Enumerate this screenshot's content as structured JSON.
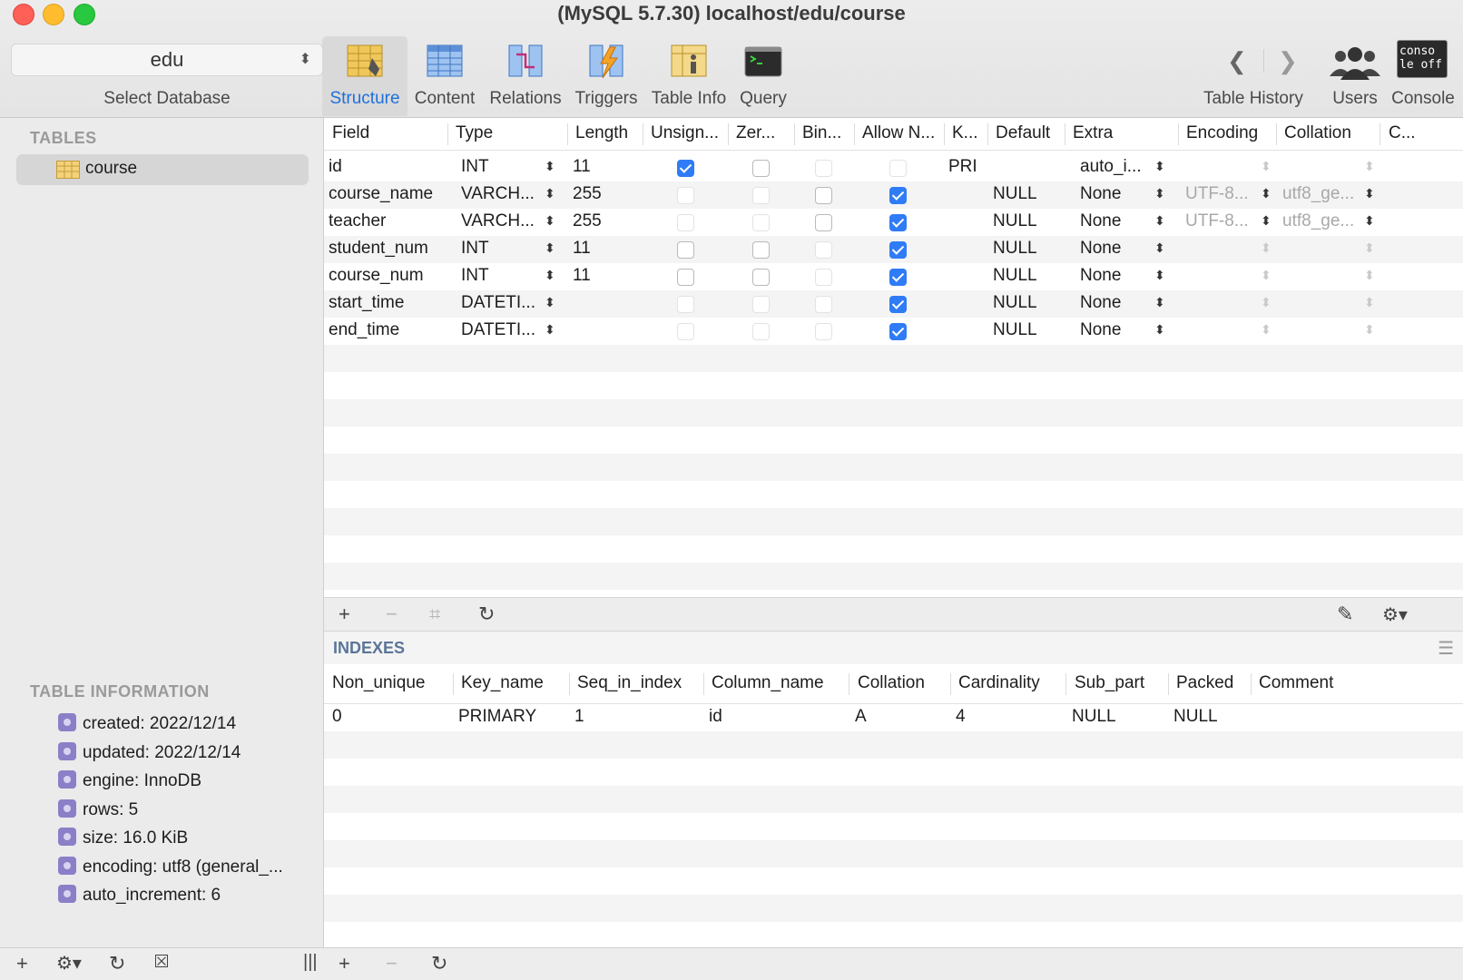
{
  "window": {
    "title": "(MySQL 5.7.30) localhost/edu/course"
  },
  "database": {
    "selected": "edu",
    "label": "Select Database"
  },
  "toolbar": {
    "tabs": [
      {
        "label": "Structure",
        "icon": "structure-icon",
        "active": true
      },
      {
        "label": "Content",
        "icon": "content-icon",
        "active": false
      },
      {
        "label": "Relations",
        "icon": "relations-icon",
        "active": false
      },
      {
        "label": "Triggers",
        "icon": "triggers-icon",
        "active": false
      },
      {
        "label": "Table Info",
        "icon": "table-info-icon",
        "active": false
      },
      {
        "label": "Query",
        "icon": "query-icon",
        "active": false
      }
    ],
    "right": {
      "history_label": "Table History",
      "users_label": "Users",
      "console_label": "Console",
      "console_icon_text": "conso le off"
    }
  },
  "sidebar": {
    "tables_heading": "TABLES",
    "tables": [
      {
        "name": "course",
        "selected": true
      }
    ],
    "info_heading": "TABLE INFORMATION",
    "info": [
      "created: 2022/12/14",
      "updated: 2022/12/14",
      "engine: InnoDB",
      "rows: 5",
      "size: 16.0 KiB",
      "encoding: utf8 (general_...",
      "auto_increment: 6"
    ]
  },
  "structure": {
    "columns": [
      "Field",
      "Type",
      "Length",
      "Unsign...",
      "Zer...",
      "Bin...",
      "Allow N...",
      "K...",
      "Default",
      "Extra",
      "Encoding",
      "Collation",
      "C..."
    ],
    "rows": [
      {
        "field": "id",
        "type": "INT",
        "length": "11",
        "unsigned": true,
        "zerofill": false,
        "binary": false,
        "allow_null": false,
        "key": "PRI",
        "default": "",
        "extra": "auto_i...",
        "encoding": "",
        "collation": ""
      },
      {
        "field": "course_name",
        "type": "VARCH...",
        "length": "255",
        "unsigned": false,
        "zerofill": false,
        "binary": false,
        "allow_null": true,
        "key": "",
        "default": "NULL",
        "extra": "None",
        "encoding": "UTF-8...",
        "collation": "utf8_ge..."
      },
      {
        "field": "teacher",
        "type": "VARCH...",
        "length": "255",
        "unsigned": false,
        "zerofill": false,
        "binary": false,
        "allow_null": true,
        "key": "",
        "default": "NULL",
        "extra": "None",
        "encoding": "UTF-8...",
        "collation": "utf8_ge..."
      },
      {
        "field": "student_num",
        "type": "INT",
        "length": "11",
        "unsigned": false,
        "zerofill": false,
        "binary": false,
        "allow_null": true,
        "key": "",
        "default": "NULL",
        "extra": "None",
        "encoding": "",
        "collation": ""
      },
      {
        "field": "course_num",
        "type": "INT",
        "length": "11",
        "unsigned": false,
        "zerofill": false,
        "binary": false,
        "allow_null": true,
        "key": "",
        "default": "NULL",
        "extra": "None",
        "encoding": "",
        "collation": ""
      },
      {
        "field": "start_time",
        "type": "DATETI...",
        "length": "",
        "unsigned": false,
        "zerofill": false,
        "binary": false,
        "allow_null": true,
        "key": "",
        "default": "NULL",
        "extra": "None",
        "encoding": "",
        "collation": ""
      },
      {
        "field": "end_time",
        "type": "DATETI...",
        "length": "",
        "unsigned": false,
        "zerofill": false,
        "binary": false,
        "allow_null": true,
        "key": "",
        "default": "NULL",
        "extra": "None",
        "encoding": "",
        "collation": ""
      }
    ]
  },
  "indexes": {
    "heading": "INDEXES",
    "columns": [
      "Non_unique",
      "Key_name",
      "Seq_in_index",
      "Column_name",
      "Collation",
      "Cardinality",
      "Sub_part",
      "Packed",
      "Comment"
    ],
    "rows": [
      [
        "0",
        "PRIMARY",
        "1",
        "id",
        "A",
        "4",
        "NULL",
        "NULL",
        ""
      ]
    ]
  },
  "colors": {
    "accent": "#1f6fdc",
    "checkbox": "#2f7cf6",
    "sidebar_bg": "#ebebeb",
    "section_heading": "#9a9a9a",
    "indexes_heading": "#5b7599"
  }
}
